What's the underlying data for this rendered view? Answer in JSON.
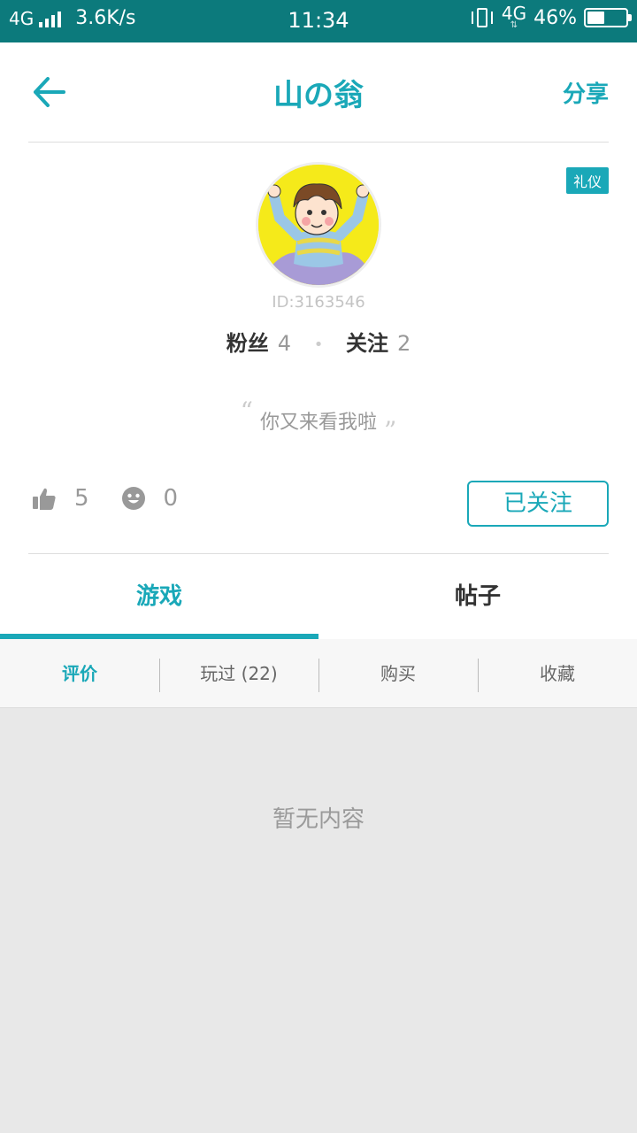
{
  "status_bar": {
    "network": "4G",
    "speed": "3.6K/s",
    "time": "11:34",
    "network_right": "4G",
    "battery_percent": "46%",
    "battery_level": 0.46
  },
  "header": {
    "title": "山の翁",
    "share_label": "分享"
  },
  "profile": {
    "badge": "礼仪",
    "user_id": "ID:3163546",
    "fans_label": "粉丝",
    "fans_count": "4",
    "following_label": "关注",
    "following_count": "2",
    "bio": "你又来看我啦",
    "likes_count": "5",
    "smiles_count": "0",
    "follow_button_label": "已关注"
  },
  "tabs": [
    {
      "label": "游戏",
      "active": true
    },
    {
      "label": "帖子",
      "active": false
    }
  ],
  "subtabs": [
    {
      "label": "评价",
      "active": true
    },
    {
      "label": "玩过 (22)",
      "active": false
    },
    {
      "label": "购买",
      "active": false
    },
    {
      "label": "收藏",
      "active": false
    }
  ],
  "content": {
    "empty_message": "暂无内容"
  },
  "colors": {
    "accent": "#1aa8b8",
    "status_bar": "#0c7a7c",
    "background": "#e8e8e8"
  },
  "icons": {
    "back": "arrow-left-icon",
    "like": "thumbs-up-icon",
    "smile": "smile-face-icon"
  }
}
